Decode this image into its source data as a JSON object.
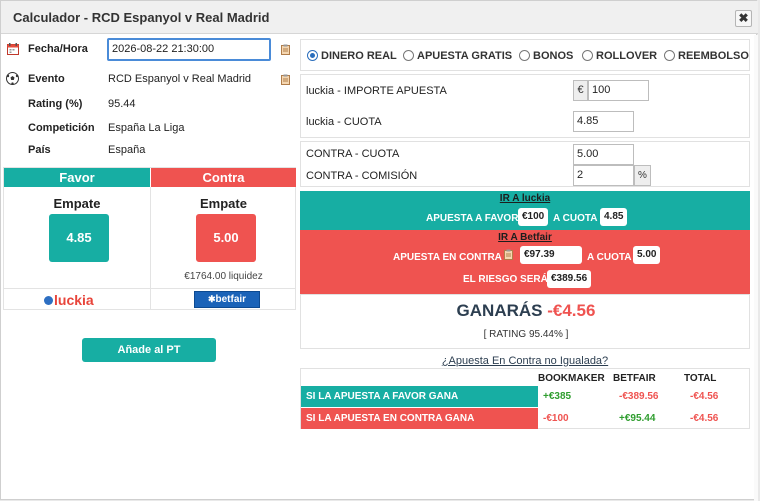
{
  "window": {
    "title": "Calculador - RCD Espanyol v Real Madrid",
    "close_symbol": "✖"
  },
  "event_info": {
    "fecha_label": "Fecha/Hora",
    "fecha_value": "2026-08-22 21:30:00",
    "evento_label": "Evento",
    "evento_value": "RCD Espanyol v Real Madrid",
    "rating_label": "Rating (%)",
    "rating_value": "95.44",
    "competicion_label": "Competición",
    "competicion_value": "España La Liga",
    "pais_label": "País",
    "pais_value": "España"
  },
  "favor": {
    "header": "Favor",
    "selection": "Empate",
    "odds": "4.85",
    "bookmaker_logo": "luckia"
  },
  "contra": {
    "header": "Contra",
    "selection": "Empate",
    "odds": "5.00",
    "liquidity": "€1764.00 liquidez",
    "exchange_logo": "betfair"
  },
  "add_button": "Añade al PT",
  "modes": [
    {
      "label": "DINERO REAL",
      "selected": true
    },
    {
      "label": "APUESTA GRATIS",
      "selected": false
    },
    {
      "label": "BONOS",
      "selected": false
    },
    {
      "label": "ROLLOVER",
      "selected": false
    },
    {
      "label": "REEMBOLSO",
      "selected": false
    }
  ],
  "stake": {
    "label": "luckia - IMPORTE APUESTA",
    "currency": "€",
    "value": "100"
  },
  "back_odds": {
    "label": "luckia - CUOTA",
    "value": "4.85"
  },
  "lay_odds": {
    "label": "CONTRA - CUOTA",
    "value": "5.00"
  },
  "commission": {
    "label": "CONTRA - COMISIÓN",
    "value": "2",
    "unit": "%"
  },
  "instructions": {
    "back_link": "IR A luckia",
    "back_text": "APUESTA A FAVOR",
    "back_amount": "€100",
    "back_at": "A CUOTA",
    "back_odds": "4.85",
    "lay_link": "IR A Betfair",
    "lay_text": "APUESTA EN CONTRA",
    "lay_amount": "€97.39",
    "lay_at": "A CUOTA",
    "lay_odds": "5.00",
    "risk_text": "EL RIESGO SERÁ",
    "risk_amount": "€389.56"
  },
  "result": {
    "label": "GANARÁS",
    "amount": "-€4.56",
    "rating": "[ RATING 95.44% ]"
  },
  "unmatched_link": "¿Apuesta En Contra no Igualada?",
  "outcomes": {
    "headers": [
      "BOOKMAKER",
      "BETFAIR",
      "TOTAL"
    ],
    "rows": [
      {
        "label": "SI LA APUESTA A FAVOR GANA",
        "bookmaker": "+€385",
        "betfair": "-€389.56",
        "total": "-€4.56"
      },
      {
        "label": "SI LA APUESTA EN CONTRA GANA",
        "bookmaker": "-€100",
        "betfair": "+€95.44",
        "total": "-€4.56"
      }
    ]
  },
  "colors": {
    "teal": "#17aea3",
    "red": "#ef5350",
    "green": "#2e9d2e",
    "link_blue": "#2a6ebd"
  }
}
